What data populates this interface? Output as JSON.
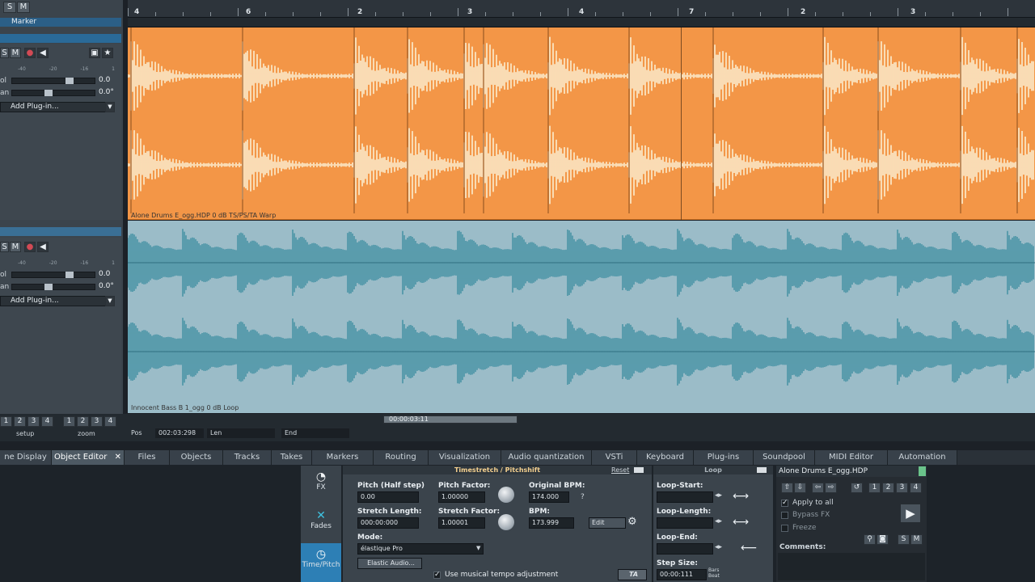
{
  "app": {
    "ruler_labels": [
      "4",
      "6",
      "2",
      "3",
      "4",
      "7",
      "2",
      "3"
    ],
    "marker_label": "Marker"
  },
  "tracks": [
    {
      "solo": "S",
      "mute": "M",
      "vol_label": "ol",
      "vol_value": "0.0",
      "pan_label": "an",
      "pan_value": "0.0°",
      "plugin_label": "Add Plug-in...",
      "clip_name": "Alone Drums E_ogg.HDP   0 dB   TS/PS/TA Warp",
      "scale": [
        "-40",
        "-20",
        "-16",
        "1"
      ]
    },
    {
      "solo": "S",
      "mute": "M",
      "vol_label": "ol",
      "vol_value": "0.0",
      "pan_label": "an",
      "pan_value": "0.0°",
      "plugin_label": "Add Plug-in...",
      "clip_name": "Innocent Bass B 1_ogg  0 dB   Loop",
      "scale": [
        "-40",
        "-20",
        "-16",
        "1"
      ]
    }
  ],
  "top_buttons": {
    "solo": "S",
    "mute": "M"
  },
  "transport": {
    "setup_nums": [
      "1",
      "2",
      "3",
      "4"
    ],
    "zoom_nums": [
      "1",
      "2",
      "3",
      "4"
    ],
    "setup_label": "setup",
    "zoom_label": "zoom",
    "scroll_time": "00:00:03:11",
    "pos_label": "Pos",
    "pos_value": "002:03:298",
    "len_label": "Len",
    "end_label": "End"
  },
  "tabs": [
    {
      "label": "ne Display"
    },
    {
      "label": "Object Editor",
      "active": true
    },
    {
      "label": "Files"
    },
    {
      "label": "Objects"
    },
    {
      "label": "Tracks"
    },
    {
      "label": "Takes"
    },
    {
      "label": "Markers"
    },
    {
      "label": "Routing"
    },
    {
      "label": "Visualization"
    },
    {
      "label": "Audio quantization"
    },
    {
      "label": "VSTi"
    },
    {
      "label": "Keyboard"
    },
    {
      "label": "Plug-ins"
    },
    {
      "label": "Soundpool"
    },
    {
      "label": "MIDI Editor"
    },
    {
      "label": "Automation"
    }
  ],
  "sidebar": {
    "fx": "FX",
    "fades": "Fades",
    "timepitch": "Time/Pitch"
  },
  "timestretch": {
    "title": "Timestretch / Pitchshift",
    "reset": "Reset",
    "pitch_label": "Pitch (Half step)",
    "pitch_value": "0.00",
    "pitch_factor_label": "Pitch Factor:",
    "pitch_factor_value": "1.00000",
    "orig_bpm_label": "Original BPM:",
    "orig_bpm_value": "174.000",
    "orig_q": "?",
    "stretch_len_label": "Stretch Length:",
    "stretch_len_value": "000:00:000",
    "stretch_factor_label": "Stretch Factor:",
    "stretch_factor_value": "1.00001",
    "bpm_label": "BPM:",
    "bpm_value": "173.999",
    "edit_label": "Edit",
    "mode_label": "Mode:",
    "mode_value": "élastique Pro",
    "elastic_btn": "Elastic Audio...",
    "musical_chk": "Use musical tempo adjustment",
    "ta_btn": "TA"
  },
  "loop": {
    "title": "Loop",
    "start_label": "Loop-Start:",
    "length_label": "Loop-Length:",
    "end_label": "Loop-End:",
    "step_label": "Step Size:",
    "step_value": "00:00:111",
    "step_unit": "Bars Beat"
  },
  "objprops": {
    "name": "Alone Drums E_ogg.HDP",
    "nums": [
      "1",
      "2",
      "3",
      "4"
    ],
    "apply_all": "Apply to all",
    "bypass": "Bypass FX",
    "freeze": "Freeze",
    "comments": "Comments:",
    "solo": "S",
    "mute": "M"
  }
}
